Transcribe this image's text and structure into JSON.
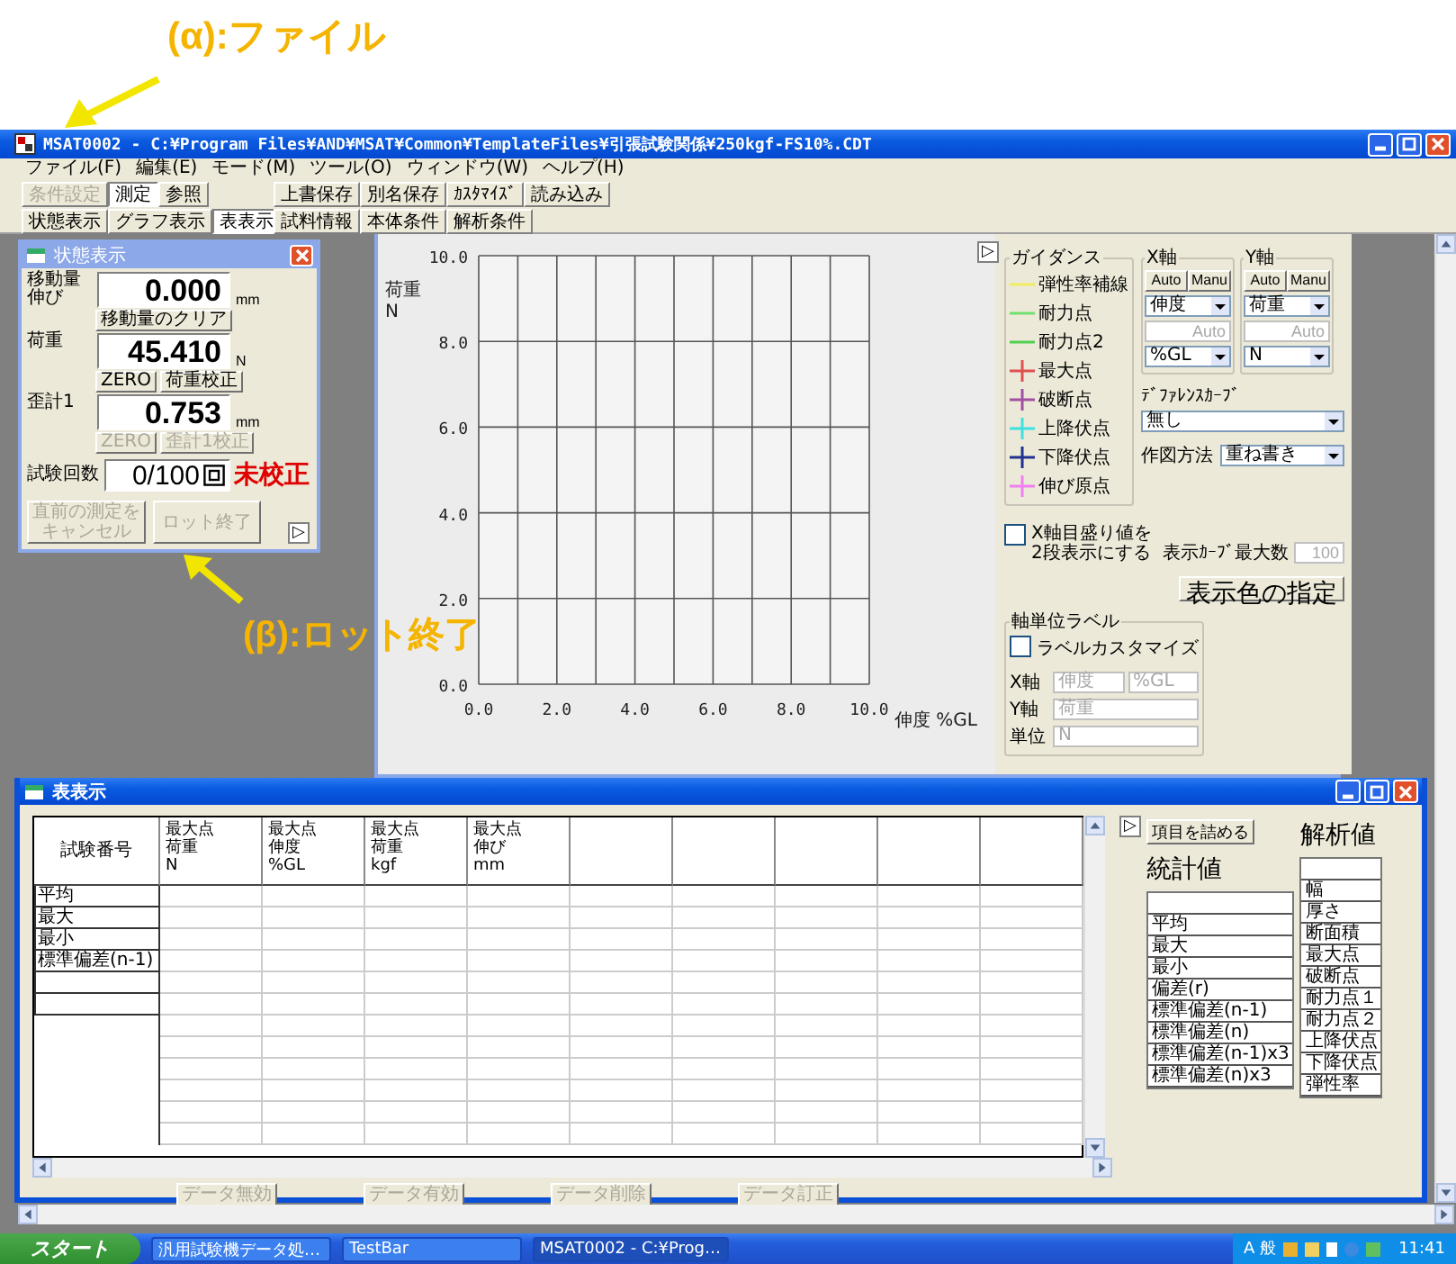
{
  "annotations": [
    {
      "label": "(α):ファイル"
    },
    {
      "label": "(β):ロット終了"
    }
  ],
  "window": {
    "title": "MSAT0002 - C:¥Program Files¥AND¥MSAT¥Common¥TemplateFiles¥引張試験関係¥250kgf-FS10%.CDT"
  },
  "menu": [
    "ファイル(F)",
    "編集(E)",
    "モード(M)",
    "ツール(O)",
    "ウィンドウ(W)",
    "ヘルプ(H)"
  ],
  "toolbar": {
    "mode_tabs": [
      {
        "label": "条件設定",
        "selected": false,
        "disabled": true
      },
      {
        "label": "測定",
        "selected": true,
        "disabled": false
      },
      {
        "label": "参照",
        "selected": false,
        "disabled": false
      }
    ],
    "file_buttons": [
      "上書保存",
      "別名保存",
      "ｶｽﾀﾏｲｽﾞ",
      "読み込み"
    ],
    "view_tabs": [
      {
        "label": "状態表示",
        "selected": false,
        "disabled": false
      },
      {
        "label": "グラフ表示",
        "selected": false,
        "disabled": false
      },
      {
        "label": "表表示",
        "selected": true,
        "disabled": false
      }
    ],
    "condition_buttons": [
      "試料情報",
      "本体条件",
      "解析条件"
    ]
  },
  "status_panel": {
    "title": "状態表示",
    "sections": [
      {
        "label": [
          "移動量",
          "伸び"
        ],
        "value": "0.000",
        "unit": "mm",
        "buttons": [
          {
            "label": "移動量のクリア",
            "disabled": false
          }
        ]
      },
      {
        "label": [
          "荷重"
        ],
        "value": "45.410",
        "unit": "N",
        "buttons": [
          {
            "label": "ZERO",
            "disabled": false
          },
          {
            "label": "荷重校正",
            "disabled": false
          }
        ]
      },
      {
        "label": [
          "歪計1"
        ],
        "value": "0.753",
        "unit": "mm",
        "buttons": [
          {
            "label": "ZERO",
            "disabled": true
          },
          {
            "label": "歪計1校正",
            "disabled": true
          }
        ]
      }
    ],
    "test_count": {
      "label": "試験回数",
      "value": "0/100",
      "status": "未校正"
    },
    "actions": [
      {
        "label": "直前の測定をキャンセル",
        "disabled": true
      },
      {
        "label": "ロット終了",
        "disabled": true
      }
    ],
    "expand_glyph": "▷"
  },
  "graph": {
    "chart_data": {
      "type": "line",
      "grid": true,
      "xlabel": "伸度 %GL",
      "ylabel": "荷重\nN",
      "xlim": [
        0,
        10
      ],
      "ylim": [
        0,
        10
      ],
      "xticks": [
        {
          "value": 0,
          "label": "0.0"
        },
        {
          "value": 2,
          "label": "2.0"
        },
        {
          "value": 4,
          "label": "4.0"
        },
        {
          "value": 6,
          "label": "6.0"
        },
        {
          "value": 8,
          "label": "8.0"
        },
        {
          "value": 10,
          "label": "10.0"
        }
      ],
      "yticks": [
        {
          "value": 0,
          "label": "0.0"
        },
        {
          "value": 2,
          "label": "2.0"
        },
        {
          "value": 4,
          "label": "4.0"
        },
        {
          "value": 6,
          "label": "6.0"
        },
        {
          "value": 8,
          "label": "8.0"
        },
        {
          "value": 10,
          "label": "10.0"
        }
      ]
    },
    "expand_glyph": "▷"
  },
  "graph_panel": {
    "guidance": {
      "title": "ガイダンス",
      "items": [
        {
          "label": "弾性率補線",
          "kind": "line",
          "color": "#f0ec60"
        },
        {
          "label": "耐力点",
          "kind": "line",
          "color": "#70e070"
        },
        {
          "label": "耐力点2",
          "kind": "line",
          "color": "#50d050"
        },
        {
          "label": "最大点",
          "kind": "cross",
          "color": "#e05050"
        },
        {
          "label": "破断点",
          "kind": "cross",
          "color": "#a050a0"
        },
        {
          "label": "上降伏点",
          "kind": "cross",
          "color": "#40e0e0"
        },
        {
          "label": "下降伏点",
          "kind": "cross",
          "color": "#203090"
        },
        {
          "label": "伸び原点",
          "kind": "cross",
          "color": "#f080f0"
        }
      ]
    },
    "axes": [
      {
        "title": "X軸",
        "modes": [
          "Auto",
          "Manu"
        ],
        "quantity": "伸度",
        "range": "Auto",
        "unit": "%GL"
      },
      {
        "title": "Y軸",
        "modes": [
          "Auto",
          "Manu"
        ],
        "quantity": "荷重",
        "range": "Auto",
        "unit": "N"
      }
    ],
    "reference_curve": {
      "label": "ﾃﾞﾌｧﾚﾝｽｶｰﾌﾞ",
      "value": "無し"
    },
    "plot_method": {
      "label": "作図方法",
      "value": "重ね書き"
    },
    "two_row_ticks": {
      "label": "X軸目盛り値を2段表示にする",
      "checked": false
    },
    "max_curves": {
      "label": "表示ｶｰﾌﾞ最大数",
      "value": "100",
      "disabled": true
    },
    "color_button": "表示色の指定",
    "axis_labels": {
      "title": "軸単位ラベル",
      "customize": {
        "label": "ラベルカスタマイズ",
        "checked": false
      },
      "fields": [
        {
          "label": "X軸",
          "values": [
            "伸度",
            "%GL"
          ],
          "disabled": true
        },
        {
          "label": "Y軸",
          "values": [
            "荷重"
          ],
          "disabled": true
        },
        {
          "label": "単位",
          "values": [
            "N"
          ],
          "disabled": true
        }
      ]
    }
  },
  "table_window": {
    "title": "表表示",
    "columns": [
      [
        "試験番号"
      ],
      [
        "最大点",
        "荷重",
        "N"
      ],
      [
        "最大点",
        "伸度",
        "%GL"
      ],
      [
        "最大点",
        "荷重",
        "kgf"
      ],
      [
        "最大点",
        "伸び",
        "mm"
      ]
    ],
    "row_labels": [
      "平均",
      "最大",
      "最小",
      "標準偏差(n-1)"
    ],
    "buttons": [
      {
        "label": "データ無効",
        "disabled": true
      },
      {
        "label": "データ有効",
        "disabled": true
      },
      {
        "label": "データ削除",
        "disabled": true
      },
      {
        "label": "データ訂正",
        "disabled": true
      }
    ],
    "expand_glyph": "▷",
    "pack_button": "項目を詰める",
    "stats": {
      "title": "統計値",
      "items": [
        "平均",
        "最大",
        "最小",
        "偏差(r)",
        "標準偏差(n-1)",
        "標準偏差(n)",
        "標準偏差(n-1)x3",
        "標準偏差(n)x3"
      ]
    },
    "analysis": {
      "title": "解析値",
      "items": [
        "幅",
        "厚さ",
        "断面積",
        "最大点",
        "破断点",
        "耐力点１",
        "耐力点２",
        "上降伏点",
        "下降伏点",
        "弾性率"
      ]
    }
  },
  "taskbar": {
    "start": "スタート",
    "tasks": [
      {
        "label": "汎用試験機データ処…",
        "selected": false
      },
      {
        "label": "TestBar",
        "selected": false
      },
      {
        "label": "MSAT0002 - C:¥Prog…",
        "selected": true
      }
    ],
    "ime": "A 般",
    "clock": "11:41"
  }
}
